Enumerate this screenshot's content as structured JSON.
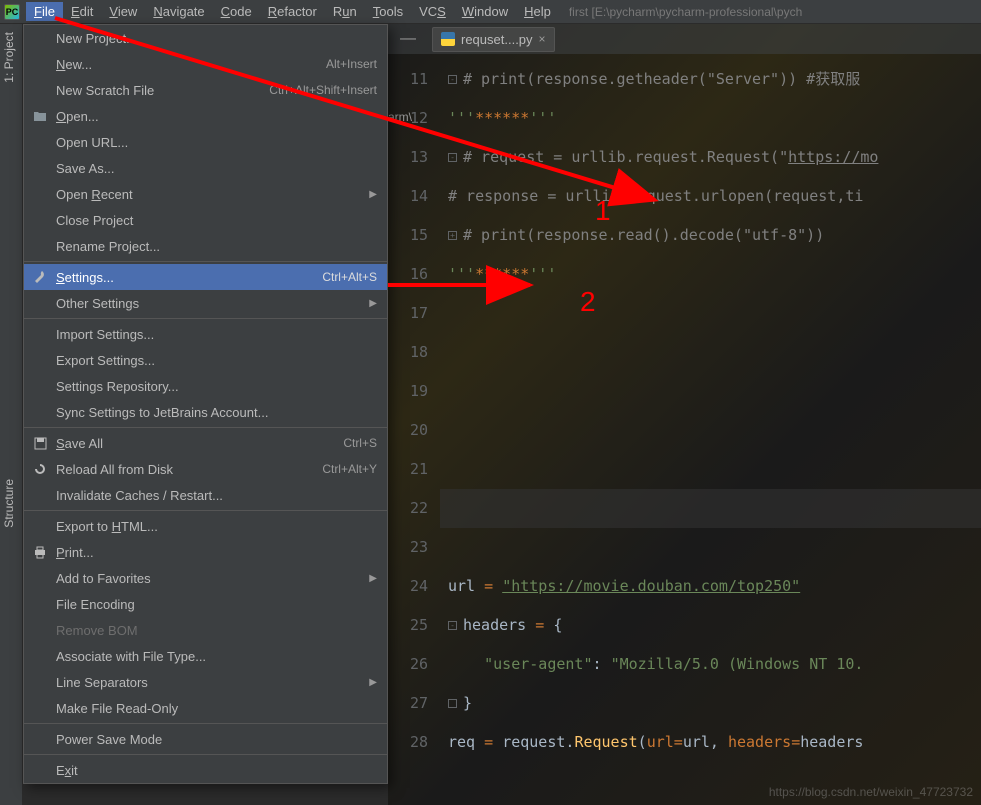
{
  "menubar": {
    "app_icon_text": "PC",
    "items": [
      "File",
      "Edit",
      "View",
      "Navigate",
      "Code",
      "Refactor",
      "Run",
      "Tools",
      "VCS",
      "Window",
      "Help"
    ],
    "underlines": [
      "F",
      "E",
      "V",
      "N",
      "C",
      "R",
      "u",
      "T",
      "S",
      "W",
      "H"
    ],
    "open_index": 0,
    "title_path": "first [E:\\pycharm\\pycharm-professional\\pych"
  },
  "sidebar": {
    "tabs": [
      {
        "label": "1: Project",
        "icon": "folder"
      },
      {
        "label": "Structure",
        "icon": "structure"
      }
    ]
  },
  "dropdown": [
    {
      "type": "item",
      "label": "New Project...",
      "icon": ""
    },
    {
      "type": "item",
      "label": "New...",
      "shortcut": "Alt+Insert",
      "underline": "N"
    },
    {
      "type": "item",
      "label": "New Scratch File",
      "shortcut": "Ctrl+Alt+Shift+Insert"
    },
    {
      "type": "item",
      "label": "Open...",
      "icon": "open-folder",
      "underline": "O"
    },
    {
      "type": "item",
      "label": "Open URL..."
    },
    {
      "type": "item",
      "label": "Save As..."
    },
    {
      "type": "item",
      "label": "Open Recent",
      "submenu": true,
      "underline": "R"
    },
    {
      "type": "item",
      "label": "Close Project"
    },
    {
      "type": "item",
      "label": "Rename Project..."
    },
    {
      "type": "hr"
    },
    {
      "type": "item",
      "label": "Settings...",
      "shortcut": "Ctrl+Alt+S",
      "icon": "wrench",
      "highlighted": true,
      "underline": "S"
    },
    {
      "type": "item",
      "label": "Other Settings",
      "submenu": true
    },
    {
      "type": "hr"
    },
    {
      "type": "item",
      "label": "Import Settings..."
    },
    {
      "type": "item",
      "label": "Export Settings..."
    },
    {
      "type": "item",
      "label": "Settings Repository..."
    },
    {
      "type": "item",
      "label": "Sync Settings to JetBrains Account..."
    },
    {
      "type": "hr"
    },
    {
      "type": "item",
      "label": "Save All",
      "shortcut": "Ctrl+S",
      "icon": "save",
      "underline": "S"
    },
    {
      "type": "item",
      "label": "Reload All from Disk",
      "shortcut": "Ctrl+Alt+Y",
      "icon": "reload"
    },
    {
      "type": "item",
      "label": "Invalidate Caches / Restart..."
    },
    {
      "type": "hr"
    },
    {
      "type": "item",
      "label": "Export to HTML...",
      "underline": "H"
    },
    {
      "type": "item",
      "label": "Print...",
      "icon": "print",
      "underline": "P"
    },
    {
      "type": "item",
      "label": "Add to Favorites",
      "submenu": true
    },
    {
      "type": "item",
      "label": "File Encoding"
    },
    {
      "type": "item",
      "label": "Remove BOM",
      "disabled": true
    },
    {
      "type": "item",
      "label": "Associate with File Type..."
    },
    {
      "type": "item",
      "label": "Line Separators",
      "submenu": true
    },
    {
      "type": "item",
      "label": "Make File Read-Only"
    },
    {
      "type": "hr"
    },
    {
      "type": "item",
      "label": "Power Save Mode"
    },
    {
      "type": "hr"
    },
    {
      "type": "item",
      "label": "Exit",
      "underline": "x"
    }
  ],
  "editor": {
    "collapse_glyph": "—",
    "tab_name": "requset....py",
    "tab_close": "×",
    "breadcrumb_fragment": "arm\\",
    "lines": [
      {
        "n": "11",
        "html": "<span class='fold-mark'>-</span><span class='c-comment'># print(response.getheader(\"Server\")) #获取服</span>"
      },
      {
        "n": "12",
        "html": "<span class='c-string'>'''</span><span class='c-stars'>******</span><span class='c-string'>'''</span>"
      },
      {
        "n": "13",
        "html": "<span class='fold-mark'>-</span><span class='c-comment'># request = urllib.request.Request(\"<u>https://mo</u></span>"
      },
      {
        "n": "14",
        "html": "<span class='c-comment'># response = urllib.request.urlopen(request,ti</span>"
      },
      {
        "n": "15",
        "html": "<span class='fold-mark'>+</span><span class='c-comment'># print(response.read().decode(\"utf-8\"))</span>"
      },
      {
        "n": "16",
        "html": "<span class='c-string'>'''</span><span class='c-stars'>******</span><span class='c-string'>'''</span>"
      },
      {
        "n": "17",
        "html": ""
      },
      {
        "n": "18",
        "html": ""
      },
      {
        "n": "19",
        "html": ""
      },
      {
        "n": "20",
        "html": ""
      },
      {
        "n": "21",
        "html": ""
      },
      {
        "n": "22",
        "html": "",
        "current": true
      },
      {
        "n": "23",
        "html": ""
      },
      {
        "n": "24",
        "html": "<span class='c-var'>url</span> <span class='c-op'>=</span> <span class='c-url'>\"https://movie.douban.com/top250\"</span>"
      },
      {
        "n": "25",
        "html": "<span class='fold-mark'>-</span><span class='c-var'>headers</span> <span class='c-op'>=</span> <span class='c-var'>{</span>"
      },
      {
        "n": "26",
        "html": "    <span class='c-key'>\"user-agent\"</span><span class='c-var'>:</span> <span class='c-string'>\"Mozilla/5.0 (Windows NT 10.</span>"
      },
      {
        "n": "27",
        "html": "<span class='fold-mark'>&nbsp;</span><span class='c-var'>}</span>"
      },
      {
        "n": "28",
        "html": "<span class='c-var'>req</span> <span class='c-op'>=</span> <span class='c-class'>request.</span><span class='c-call'>Request</span><span class='c-var'>(</span><span class='c-param'>url</span><span class='c-op'>=</span><span class='c-var'>url,</span> <span class='c-param'>headers</span><span class='c-op'>=</span><span class='c-var'>headers</span>"
      }
    ]
  },
  "annotations": {
    "label1": "1",
    "label2": "2"
  },
  "watermark": "https://blog.csdn.net/weixin_47723732"
}
